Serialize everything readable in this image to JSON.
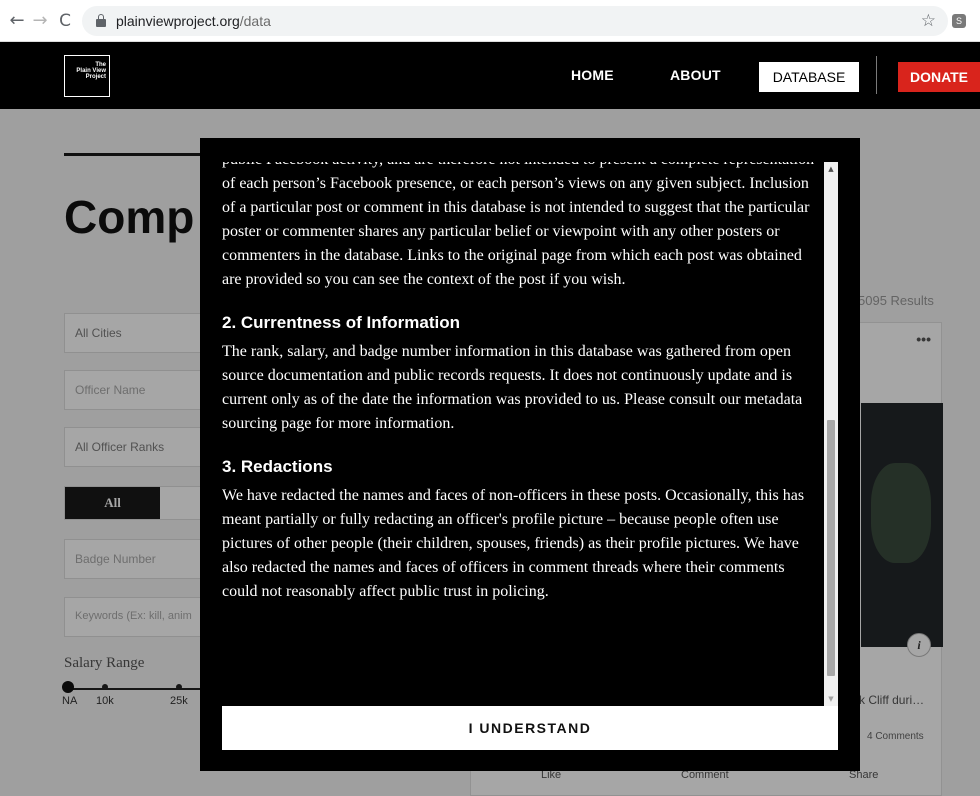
{
  "browser": {
    "url_domain": "plainviewproject.org",
    "url_path": "/data",
    "back_glyph": "←",
    "forward_glyph": "→",
    "reload_glyph": "C",
    "star_glyph": "☆",
    "extension_glyph": "S"
  },
  "header": {
    "logo_lines": [
      "The",
      "Plain View",
      "Project"
    ],
    "nav": {
      "home": "HOME",
      "about": "ABOUT",
      "database": "DATABASE",
      "donate": "DONATE"
    },
    "colors": {
      "background": "#000000",
      "donate": "#d9241c"
    }
  },
  "background_page": {
    "heading": "Comp",
    "filters": {
      "cities": "All Cities",
      "officer_name": "Officer Name",
      "ranks": "All Officer Ranks",
      "badge": "Badge Number",
      "keywords": "Keywords (Ex: kill, anim"
    },
    "segment_all": "All",
    "salary_label": "Salary Range",
    "salary_ticks": [
      "NA",
      "10k",
      "25k"
    ],
    "results": "5095 Results",
    "card": {
      "menu": "•••",
      "info": "i",
      "caption": "k Cliff duri…",
      "comments": "4 Comments",
      "actions": [
        "Like",
        "Comment",
        "Share"
      ]
    }
  },
  "modal": {
    "intro_paragraph": "public Facebook activity, and are therefore not intended to present a complete representation of each person’s Facebook presence, or each person’s views on any given subject. Inclusion of a particular post or comment in this database is not intended to suggest that the particular poster or commenter shares any particular belief or viewpoint with any other posters or commenters in the database. Links to the original page from which each post was obtained are provided so you can see the context of the post if you wish.",
    "sections": [
      {
        "heading": "2. Currentness of Information",
        "body": "The rank, salary, and badge number information in this database was gathered from open source documentation and public records requests. It does not continuously update and is current only as of the date the information was provided to us. Please consult our metadata sourcing page for more information."
      },
      {
        "heading": "3. Redactions",
        "body": "We have redacted the names and faces of non-officers in these posts. Occasionally, this has meant partially or fully redacting an officer's profile picture – because people often use pictures of other people (their children, spouses, friends) as their profile pictures. We have also redacted the names and faces of officers in comment threads where their comments could not reasonably affect public trust in policing."
      }
    ],
    "scroll_up_glyph": "▲",
    "scroll_down_glyph": "▼",
    "confirm_button": "I UNDERSTAND"
  }
}
